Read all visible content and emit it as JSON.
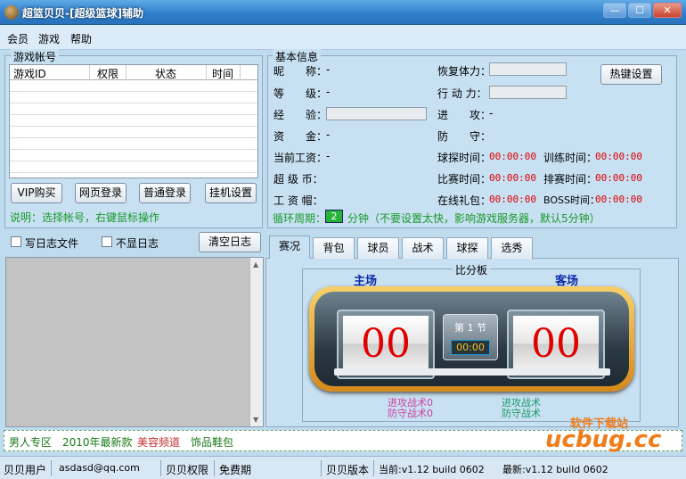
{
  "window": {
    "title": "超篮贝贝-[超级篮球]辅助",
    "min": "—",
    "max": "☐",
    "close": "✕"
  },
  "menu": [
    "会员",
    "游戏",
    "帮助"
  ],
  "accounts": {
    "legend": "游戏帐号",
    "columns": [
      "游戏ID",
      "权限",
      "状态",
      "时间"
    ],
    "buttons": [
      "VIP购买",
      "网页登录",
      "普通登录",
      "挂机设置"
    ],
    "hint": "说明：选择帐号，右键鼠标操作"
  },
  "log": {
    "write_log": "写日志文件",
    "hide_log": "不显日志",
    "clear": "清空日志"
  },
  "info": {
    "legend": "基本信息",
    "left": [
      {
        "label": "昵　　称：",
        "value": "-"
      },
      {
        "label": "等　　级：",
        "value": "-"
      },
      {
        "label": "经　　验：",
        "value": ""
      },
      {
        "label": "资　　金：",
        "value": "-"
      },
      {
        "label": "当前工资：",
        "value": "-"
      },
      {
        "label": "超 级 币：",
        "value": ""
      },
      {
        "label": "工 资 帽：",
        "value": ""
      }
    ],
    "mid": [
      {
        "label": "恢复体力：",
        "value": ""
      },
      {
        "label": "行 动 力：",
        "value": ""
      },
      {
        "label": "进　　攻：",
        "value": "-"
      },
      {
        "label": "防　　守：",
        "value": ""
      },
      {
        "label": "球探时间：",
        "value": "00:00:00"
      },
      {
        "label": "比赛时间：",
        "value": "00:00:00"
      },
      {
        "label": "在线礼包：",
        "value": "00:00:00"
      }
    ],
    "right": [
      {
        "label": "训练时间：",
        "value": "00:00:00"
      },
      {
        "label": "排赛时间：",
        "value": "00:00:00"
      },
      {
        "label": "BOSS时间：",
        "value": "00:00:00"
      }
    ],
    "hotkey": "热键设置",
    "cycle_label": "循环周期：",
    "cycle_value": "2",
    "cycle_note": "分钟（不要设置太快，影响游戏服务器，默认5分钟）"
  },
  "tabs": [
    "赛况",
    "背包",
    "球员",
    "战术",
    "球探",
    "选秀"
  ],
  "score": {
    "legend": "比分板",
    "home": "主场",
    "away": "客场",
    "home_score": "00",
    "away_score": "00",
    "period": "第 1 节",
    "clock": "00:00",
    "home_attack": "进攻战术0",
    "home_defense": "防守战术0",
    "away_attack": "进攻战术",
    "away_defense": "防守战术"
  },
  "ads": [
    "男人专区",
    "2010年最新款",
    "美容频道",
    "饰品鞋包"
  ],
  "watermark": "软件下载站",
  "watermark_logo": "ucbug.cc",
  "status": {
    "user_label": "贝贝用户",
    "user": "asdasd@qq.com",
    "perm_label": "贝贝权限",
    "perm": "免费期",
    "ver_label": "贝贝版本",
    "current": "当前:v1.12 build 0602",
    "latest": "最新:v1.12 build 0602"
  },
  "colors": {
    "titlebar": "#2f7fcc",
    "red": "#e00000",
    "green": "#1a9a2a",
    "panel": "#c7e0f2"
  }
}
